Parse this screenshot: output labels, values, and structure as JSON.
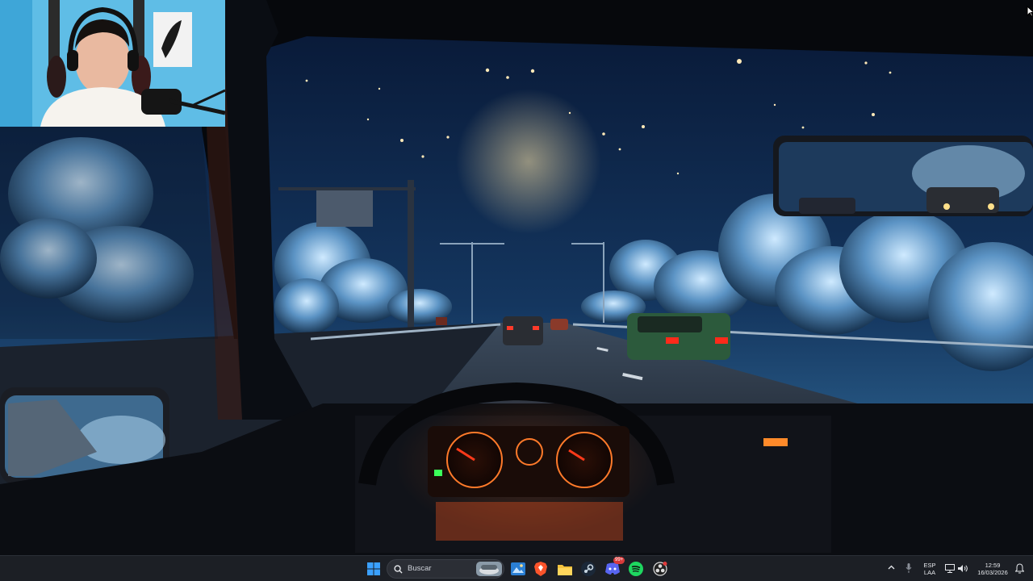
{
  "wallpaper": {
    "description_icon": "lofi-night-drive-wallpaper",
    "colors": {
      "sky_top": "#0a1a38",
      "sky_bottom": "#2a5a8a",
      "moon": "#f3d9a0",
      "dash_glow": "#ff5a1f",
      "road": "#1a1f2a"
    }
  },
  "webcam": {
    "icon": "streamer-webcam-overlay"
  },
  "taskbar": {
    "search_placeholder": "Buscar",
    "apps": [
      {
        "name": "start-icon"
      },
      {
        "name": "search-icon"
      },
      {
        "name": "widget-icon"
      },
      {
        "name": "photos-icon"
      },
      {
        "name": "brave-icon"
      },
      {
        "name": "file-explorer-icon"
      },
      {
        "name": "steam-icon"
      },
      {
        "name": "discord-icon",
        "badge": "99+"
      },
      {
        "name": "spotify-icon"
      },
      {
        "name": "obs-icon"
      }
    ],
    "tray": {
      "language_top": "ESP",
      "language_bottom": "LAA",
      "time": "12:59",
      "date": "16/03/2026"
    }
  }
}
